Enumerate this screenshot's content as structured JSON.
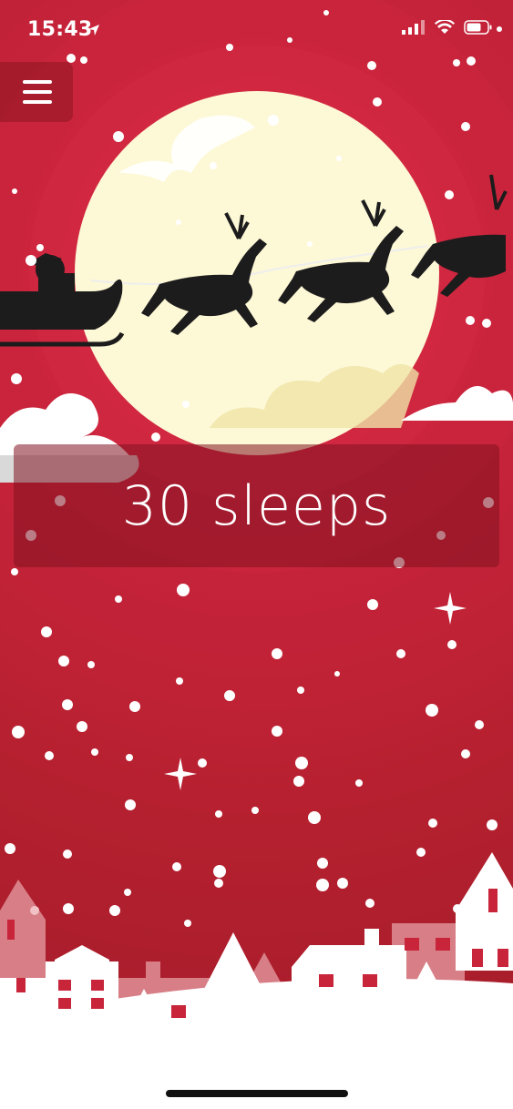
{
  "status_bar": {
    "time": "15:43",
    "icons": [
      "location-arrow-icon",
      "signal-icon",
      "wifi-icon",
      "battery-icon"
    ]
  },
  "menu": {
    "icon": "hamburger-menu-icon"
  },
  "countdown": {
    "label": "30 sleeps"
  },
  "colors": {
    "background": "#c8243a",
    "moon": "#fdf8d6",
    "silhouette": "#1c1c1c",
    "snow": "#ffffff"
  }
}
